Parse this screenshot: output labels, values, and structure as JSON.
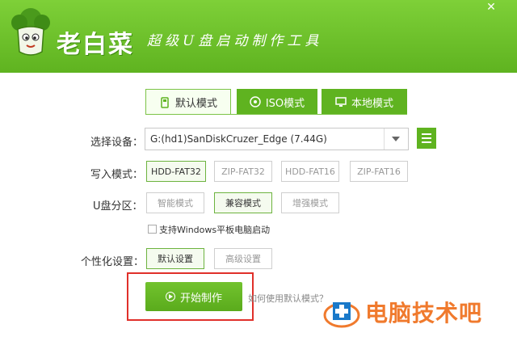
{
  "header": {
    "app_title": "老白菜",
    "subtitle": "超级U盘启动制作工具",
    "close_glyph": "✕"
  },
  "tabs": [
    {
      "label": "默认模式",
      "icon": "usb-icon",
      "active": true
    },
    {
      "label": "ISO模式",
      "icon": "disc-icon",
      "active": false
    },
    {
      "label": "本地模式",
      "icon": "monitor-icon",
      "active": false
    }
  ],
  "device": {
    "label": "选择设备：",
    "value": "G:(hd1)SanDiskCruzer_Edge (7.44G)"
  },
  "write_mode": {
    "label": "写入模式：",
    "options": [
      "HDD-FAT32",
      "ZIP-FAT32",
      "HDD-FAT16",
      "ZIP-FAT16"
    ],
    "selected": "HDD-FAT32"
  },
  "partition": {
    "label": "U盘分区：",
    "options": [
      "智能模式",
      "兼容模式",
      "增强模式"
    ],
    "selected": "兼容模式"
  },
  "tablet_boot": {
    "label": "支持Windows平板电脑启动",
    "checked": false
  },
  "personalize": {
    "label": "个性化设置：",
    "options": [
      "默认设置",
      "高级设置"
    ],
    "selected": "默认设置"
  },
  "start_button": {
    "label": "开始制作"
  },
  "help_link": "如何使用默认模式？",
  "watermark": {
    "text": "电脑技术吧"
  },
  "colors": {
    "brand_green": "#5fb320",
    "highlight_red": "#e0302a",
    "watermark_orange": "#f07a2d"
  }
}
